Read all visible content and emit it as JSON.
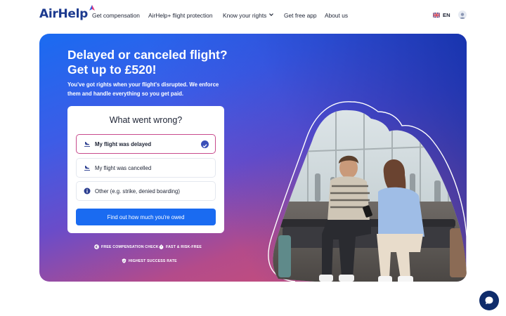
{
  "brand": {
    "name": "AirHelp"
  },
  "nav": {
    "items": [
      {
        "label": "Get compensation"
      },
      {
        "label": "AirHelp+ flight protection"
      },
      {
        "label": "Know your rights"
      },
      {
        "label": "Get free app"
      },
      {
        "label": "About us"
      }
    ],
    "language": "EN"
  },
  "hero": {
    "title_line1": "Delayed or canceled flight?",
    "title_line2": "Get up to £520!",
    "subtitle": "You've got rights when your flight's disrupted. We enforce them and handle everything so you get paid."
  },
  "form": {
    "title": "What went wrong?",
    "options": [
      {
        "label": "My flight was delayed",
        "icon": "plane-landing-icon",
        "selected": true
      },
      {
        "label": "My flight was cancelled",
        "icon": "plane-landing-icon",
        "selected": false
      },
      {
        "label": "Other (e.g. strike, denied boarding)",
        "icon": "info-icon",
        "selected": false
      }
    ],
    "cta": "Find out how much you're owed"
  },
  "badges": [
    {
      "label": "FREE COMPENSATION CHECK",
      "icon": "euro-icon"
    },
    {
      "label": "FAST & RISK-FREE",
      "icon": "stopwatch-icon"
    },
    {
      "label": "HIGHEST SUCCESS RATE",
      "icon": "shield-check-icon"
    }
  ],
  "colors": {
    "brand_blue": "#1a6bf1",
    "navy": "#1c3a8f",
    "selected_border": "#c84b8c",
    "chat_bg": "#0f2c6b"
  }
}
